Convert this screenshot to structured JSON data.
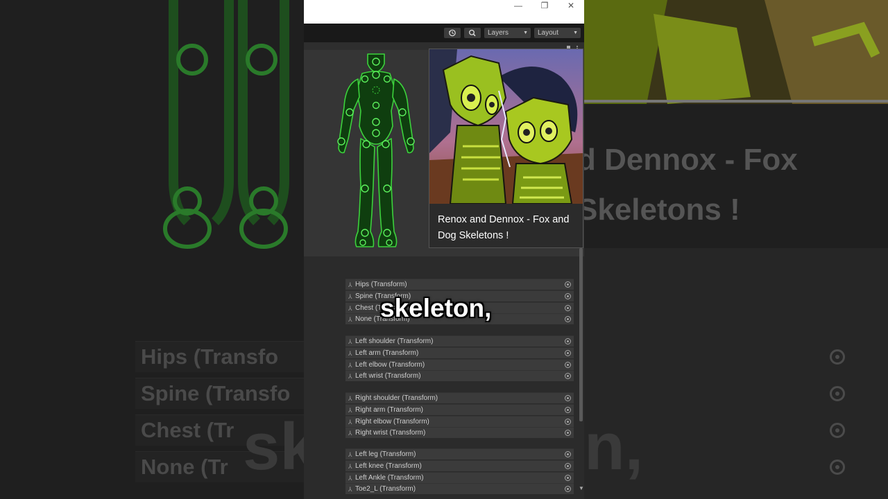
{
  "window": {
    "minimize_glyph": "—",
    "maximize_glyph": "❐",
    "close_glyph": "✕"
  },
  "toolbar": {
    "history_icon": "history-icon",
    "search_icon": "search-icon",
    "layers_label": "Layers",
    "layout_label": "Layout",
    "caret": "▼"
  },
  "popup": {
    "title": "Renox and Dennox - Fox and Dog Skeletons !"
  },
  "bone_groups": [
    [
      "Hips (Transform)",
      "Spine (Transform)",
      "Chest (Transform)",
      "None (Transform)"
    ],
    [
      "Left  shoulder (Transform)",
      "Left arm (Transform)",
      "Left elbow (Transform)",
      "Left wrist (Transform)"
    ],
    [
      "Right  shoulder (Transform)",
      "Right arm (Transform)",
      "Right elbow (Transform)",
      "Right wrist (Transform)"
    ],
    [
      "Left leg (Transform)",
      "Left knee (Transform)",
      "Left Ankle (Transform)",
      "Toe2_L (Transform)"
    ]
  ],
  "subtitle": "skeleton,",
  "background": {
    "left_rows": [
      "Hips (Transfo",
      "Spine (Transfo",
      "Chest (Tr",
      "None (Tr"
    ],
    "right_title_line1": "d Dennox - Fox",
    "right_title_line2": "Skeletons !",
    "subtitle_left": "ske",
    "subtitle_right": "n,"
  },
  "colors": {
    "rig_green": "#3cd23c",
    "panel": "#383838",
    "subtitle": "#ffffff"
  }
}
